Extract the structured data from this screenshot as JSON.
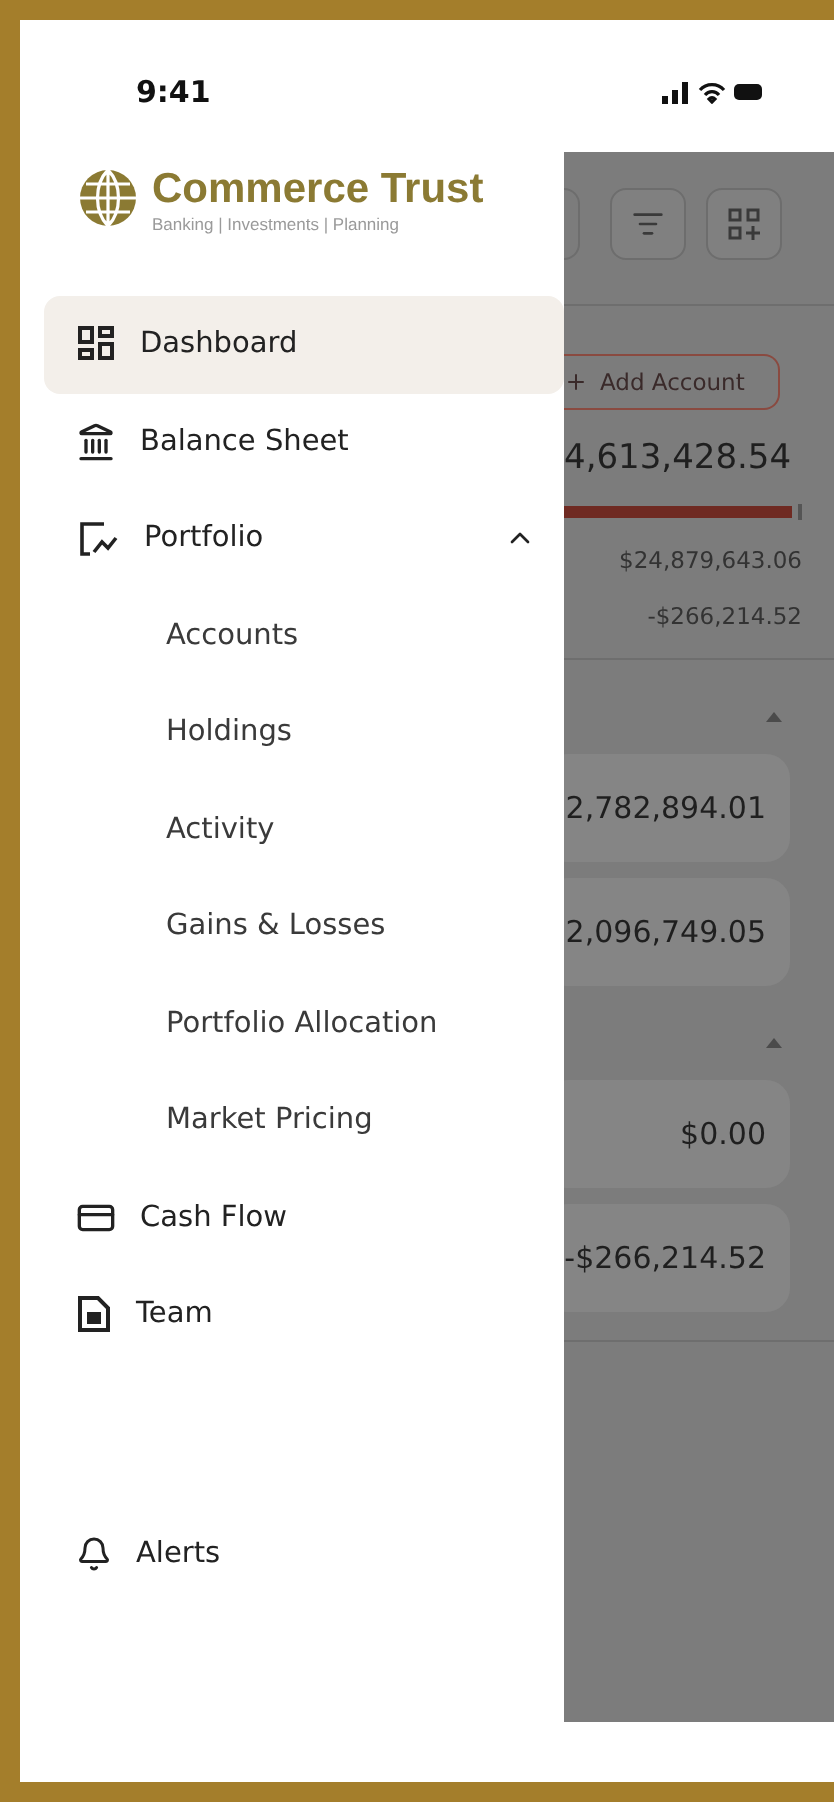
{
  "status_bar": {
    "time": "9:41"
  },
  "logo": {
    "name": "Commerce Trust",
    "tagline": "Banking | Investments | Planning"
  },
  "nav": [
    {
      "label": "Dashboard",
      "selected": true
    },
    {
      "label": "Balance Sheet",
      "selected": false
    },
    {
      "label": "Portfolio",
      "selected": false,
      "expanded": true,
      "children": [
        {
          "label": "Accounts"
        },
        {
          "label": "Holdings"
        },
        {
          "label": "Activity"
        },
        {
          "label": "Gains & Losses"
        },
        {
          "label": "Portfolio Allocation"
        },
        {
          "label": "Market Pricing"
        }
      ]
    },
    {
      "label": "Cash Flow",
      "selected": false
    },
    {
      "label": "Team",
      "selected": false
    }
  ],
  "footer_nav": [
    {
      "label": "Alerts",
      "selected": false
    }
  ],
  "background": {
    "add_button": "Add Account",
    "total": "4,613,428.54",
    "level": 0.96,
    "assets": "$24,879,643.06",
    "liabilities": "-$266,214.52",
    "groups": [
      {
        "expanded": true,
        "rows": [
          "2,782,894.01",
          "2,096,749.05"
        ]
      },
      {
        "expanded": true,
        "rows": [
          "$0.00",
          "-$266,214.52"
        ]
      }
    ]
  }
}
